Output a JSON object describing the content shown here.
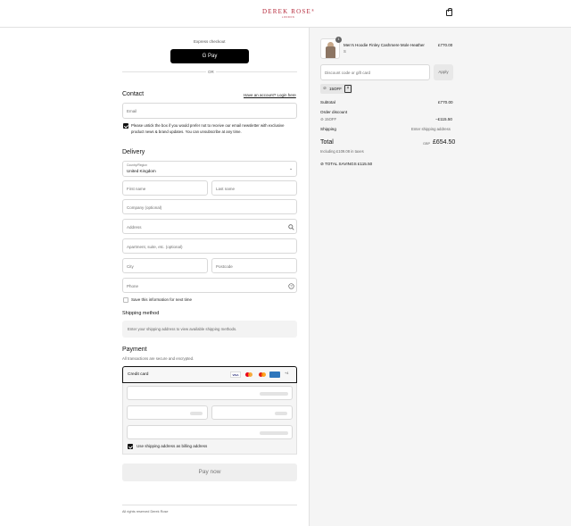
{
  "brand": {
    "name": "DEREK ROSE",
    "mark": "®",
    "sub": "LONDON"
  },
  "express": {
    "title": "Express checkout",
    "gpay_label": "G Pay",
    "or": "OR"
  },
  "contact": {
    "title": "Contact",
    "login_link": "Have an account? Login here",
    "email_placeholder": "Email",
    "newsletter_text": "Please untick the box if you would prefer not to receive our email newsletter with exclusive product news & brand updates. You can unsubscribe at any time."
  },
  "delivery": {
    "title": "Delivery",
    "country_label": "Country/Region",
    "country_value": "United Kingdom",
    "first_name": "First name",
    "last_name": "Last name",
    "company": "Company (optional)",
    "address": "Address",
    "apartment": "Apartment, suite, etc. (optional)",
    "city": "City",
    "postcode": "Postcode",
    "phone": "Phone",
    "save_info": "Save this information for next time"
  },
  "shipping_method": {
    "title": "Shipping method",
    "note": "Enter your shipping address to view available shipping methods."
  },
  "payment": {
    "title": "Payment",
    "subtitle": "All transactions are secure and encrypted.",
    "credit_card": "Credit card",
    "cards": [
      "VISA",
      "MC",
      "MAESTRO",
      "AMEX"
    ],
    "more_cards": "+4",
    "billing_same": "Use shipping address as billing address",
    "pay_now": "Pay now"
  },
  "footer": {
    "rights": "All rights reserved Derek Rose"
  },
  "summary": {
    "item_name": "Men's Hoodie Finley Cashmere Mole Heather",
    "item_size": "S",
    "item_qty": "1",
    "item_price": "£770.00",
    "discount_placeholder": "Discount code or gift card",
    "apply": "Apply",
    "code": "15OFF",
    "subtotal_label": "Subtotal",
    "subtotal_value": "£770.00",
    "order_discount_label": "Order discount",
    "order_discount_code": "15OFF",
    "order_discount_value": "−£115.50",
    "shipping_label": "Shipping",
    "shipping_value": "Enter shipping address",
    "total_label": "Total",
    "currency": "GBP",
    "total_value": "£654.50",
    "taxes": "Including £109.08 in taxes",
    "savings_label": "TOTAL SAVINGS",
    "savings_value": "£115.50"
  },
  "colors": {
    "brand": "#b5283a",
    "button": "#000000",
    "panel": "#f5f5f5"
  }
}
